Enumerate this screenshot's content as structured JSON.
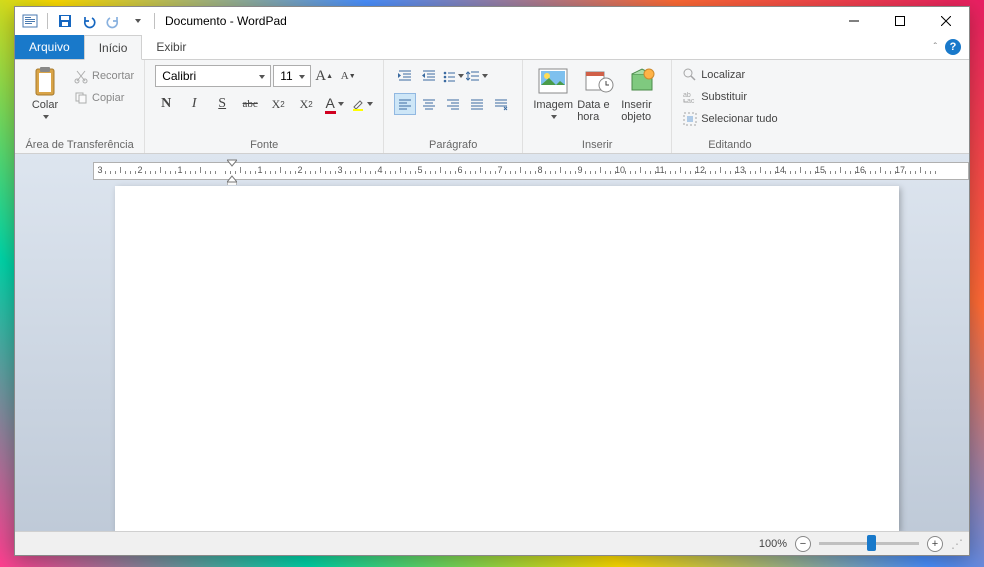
{
  "title": "Documento - WordPad",
  "tabs": {
    "file": "Arquivo",
    "home": "Início",
    "view": "Exibir"
  },
  "clipboard": {
    "paste": "Colar",
    "cut": "Recortar",
    "copy": "Copiar",
    "group": "Área de Transferência"
  },
  "font": {
    "family": "Calibri",
    "size": "11",
    "group": "Fonte"
  },
  "paragraph": {
    "group": "Parágrafo"
  },
  "insert": {
    "image": "Imagem",
    "datetime": "Data e hora",
    "object": "Inserir objeto",
    "group": "Inserir"
  },
  "editing": {
    "find": "Localizar",
    "replace": "Substituir",
    "selectall": "Selecionar tudo",
    "group": "Editando"
  },
  "ruler": [
    "3",
    "2",
    "1",
    "",
    "1",
    "2",
    "3",
    "4",
    "5",
    "6",
    "7",
    "8",
    "9",
    "10",
    "11",
    "12",
    "13",
    "14",
    "15",
    "16",
    "17"
  ],
  "status": {
    "zoom": "100%"
  }
}
